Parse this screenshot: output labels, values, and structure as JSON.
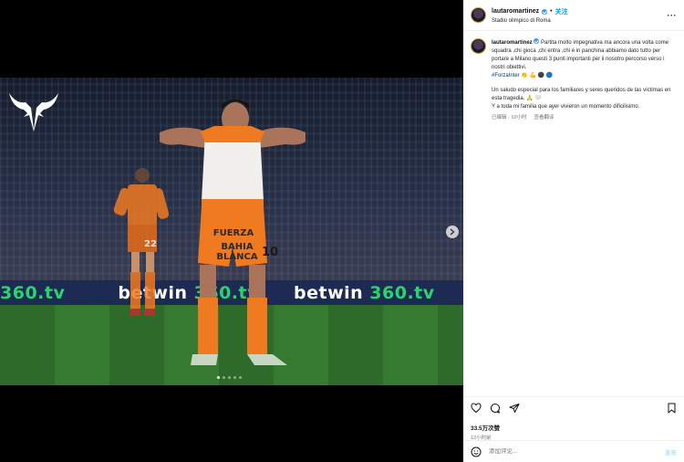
{
  "media": {
    "ad_boards": [
      {
        "prefix": "",
        "brand": "360.tv"
      },
      {
        "prefix": "betwin ",
        "brand": "360.tv"
      },
      {
        "prefix": "betwin ",
        "brand": "360.tv"
      },
      {
        "prefix": "be",
        "brand": ""
      }
    ],
    "shirt_lines": [
      "FUERZA",
      "BAHIA BLANCA"
    ],
    "main_number": "10",
    "bg_number": "22",
    "carousel_dots": 5,
    "carousel_active": 0,
    "logo_icon": "bull-logo-icon"
  },
  "post": {
    "username": "lautaromartinez",
    "follow_label": "关注",
    "separator": "•",
    "location": "Stadio olimpico di Roma",
    "more_icon": "···",
    "caption": {
      "text_it": "Partita molto impegnativa ma ancora una volta come squadra ,chi gioca ,chi entra ,chi è in panchina abbiamo dato tutto per portare a Milano questi 3 punti importanti per il nosotro percorso verso i nostri obiettivi.",
      "hashtag": "#ForzaInter",
      "emojis_1": "👏 💪 ⚫ 🔵",
      "text_es_1": "Un saludo especial para los familiares y seres queridos de las víctimas en esta tragedia.",
      "emojis_2": "🙏 🤍",
      "text_es_2": "Y a toda mi familia que ayer vivieron un momento dificilisimo.",
      "edited_label": "已编辑",
      "time_label": "10小时",
      "translate_label": "查看翻译"
    },
    "likes": "33.5万次赞",
    "post_time": "12小时前",
    "comment_placeholder": "添加评论...",
    "post_button": "发布"
  },
  "colors": {
    "accent": "#0095f6",
    "jersey_orange": "#f07a20",
    "pitch_green": "#2e6b2a",
    "board_blue": "#1c2a54",
    "board_green": "#2ad36b"
  }
}
